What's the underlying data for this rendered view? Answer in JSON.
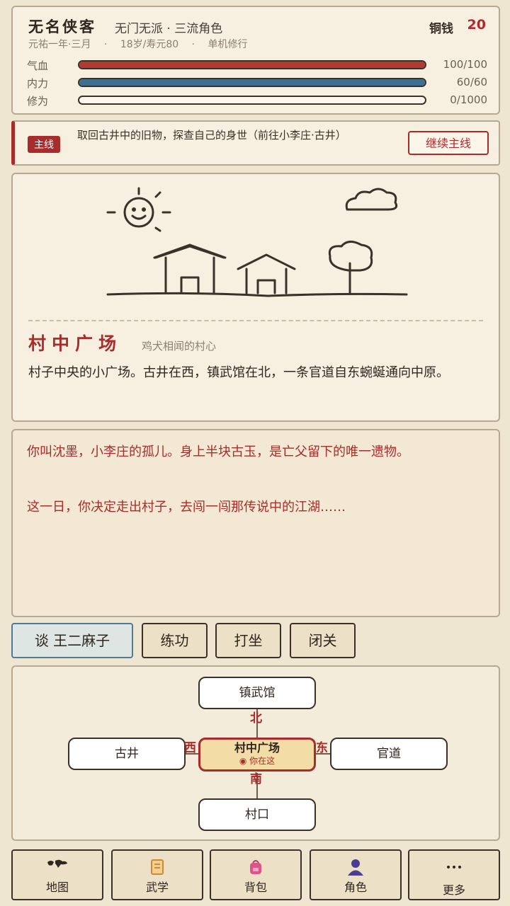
{
  "status": {
    "name": "无名侠客",
    "sect": "无门无派 · 三流角色",
    "coin_label": "铜钱",
    "coin_value": "20",
    "meta": [
      "元祐一年·三月",
      "·",
      "18岁/寿元80",
      "·",
      "单机修行"
    ],
    "bars": [
      {
        "label": "气血",
        "value": "100/100",
        "fraction": 1.0,
        "color": "#b23a32"
      },
      {
        "label": "内力",
        "value": "60/60",
        "fraction": 1.0,
        "color": "#3f6f8f"
      },
      {
        "label": "修为",
        "value": "0/1000",
        "fraction": 0.0,
        "color": "#c9a94a"
      }
    ]
  },
  "quest": {
    "tag": "主线",
    "text": "取回古井中的旧物，探查自己的身世（前往小李庄·古井）",
    "button": "继续主线"
  },
  "scene": {
    "location_name": "村中广场",
    "location_sub": "鸡犬相闻的村心",
    "description": "村子中央的小广场。古井在西，镇武馆在北，一条官道自东蜿蜒通向中原。"
  },
  "log": {
    "lines": [
      "你叫沈墨，小李庄的孤儿。身上半块古玉，是亡父留下的唯一遗物。",
      "这一日，你决定走出村子，去闯一闯那传说中的江湖……"
    ]
  },
  "actions": [
    "谈 王二麻子",
    "练功",
    "打坐",
    "闭关"
  ],
  "map": {
    "north": "镇武馆",
    "west": "古井",
    "east": "官道",
    "south": "村口",
    "current": "村中广场",
    "current_sub": "◉ 你在这",
    "dir_north": "北",
    "dir_south": "南",
    "dir_west": "西",
    "dir_east": "东"
  },
  "nav": [
    {
      "label": "地图",
      "icon": "world-map-icon"
    },
    {
      "label": "武学",
      "icon": "scroll-icon"
    },
    {
      "label": "背包",
      "icon": "backpack-icon"
    },
    {
      "label": "角色",
      "icon": "person-icon"
    },
    {
      "label": "更多",
      "icon": "more-icon"
    }
  ],
  "colors": {
    "accent": "#a82c2c",
    "background": "#efe6d2",
    "panel": "#f7f0e1"
  }
}
